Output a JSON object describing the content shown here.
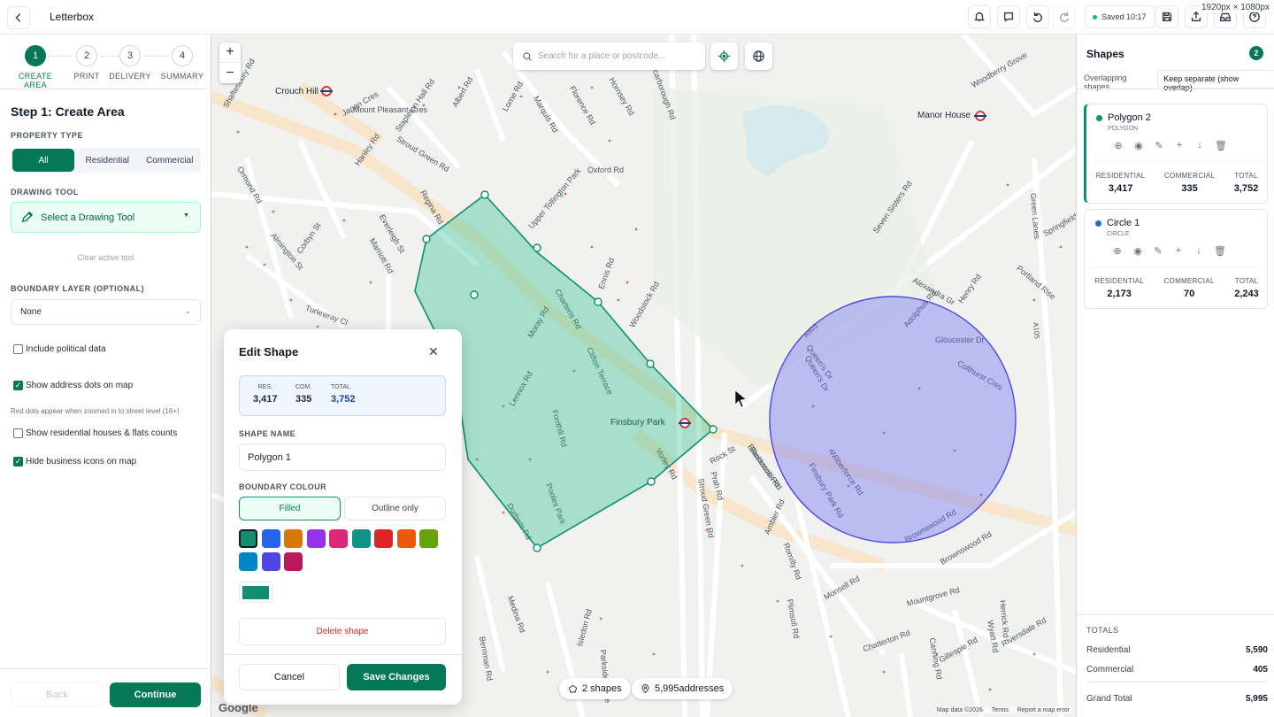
{
  "header": {
    "app_title": "Letterbox",
    "saved_status": "Saved 10:17",
    "resolution": "1920px × 1080px"
  },
  "steps": [
    {
      "num": "1",
      "label": "CREATE AREA"
    },
    {
      "num": "2",
      "label": "PRINT"
    },
    {
      "num": "3",
      "label": "DELIVERY"
    },
    {
      "num": "4",
      "label": "SUMMARY"
    }
  ],
  "left": {
    "heading": "Step 1: Create Area",
    "property_type_label": "PROPERTY TYPE",
    "property_types": [
      "All",
      "Residential",
      "Commercial"
    ],
    "drawing_tool_label": "DRAWING TOOL",
    "drawing_tool_value": "Select a Drawing Tool",
    "clear_tool": "Clear active tool",
    "boundary_label": "BOUNDARY LAYER (OPTIONAL)",
    "boundary_value": "None",
    "include_political": "Include political data",
    "show_dots": "Show address dots on map",
    "dots_hint": "Red dots appear when zoomed in to street level (16+)",
    "show_counts": "Show residential houses & flats counts",
    "hide_business": "Hide business icons on map",
    "back": "Back",
    "continue": "Continue"
  },
  "map": {
    "search_placeholder": "Search for a place or postcode...",
    "zoom_in": "+",
    "zoom_out": "−",
    "shapes_pill": "2 shapes",
    "addresses_pill": "5,995addresses",
    "attribution": [
      "Map data ©2026",
      "Terms",
      "Report a map error"
    ],
    "google": "Google",
    "labels": [
      "Crouch Hill",
      "Manor House",
      "Finsbury Park",
      "Stroud Green Rd",
      "Seven Sisters Rd",
      "Blackstock Rd",
      "Brownswood Rd",
      "Green Lanes",
      "Queen's Dr",
      "Wilberforce Rd",
      "Gloucester Dr",
      "Oxford Rd",
      "Clifton Terrace",
      "Fonthill Rd",
      "Lennox Rd",
      "Upper Tollington Park",
      "Woodstock Rd",
      "Stapleton Hall Rd",
      "Albert Rd",
      "Marquis Rd",
      "Florence Rd",
      "Hornsey Rd",
      "Mount Pleasant Cres",
      "Hanley Rd",
      "Everleigh St",
      "Marriott Rd",
      "Corbyn St",
      "Almington St",
      "Ormond Rd",
      "Turlewray Cl",
      "Durham Rd",
      "Pooles Park",
      "Medina Rd",
      "Isledon Rd",
      "Romilly Rd",
      "Plimsoll Rd",
      "Mountgrove Rd",
      "Chatterton Rd",
      "Monsell Rd",
      "Gillespie Rd",
      "Riversdale Rd",
      "Canning Rd",
      "Wyatt Rd",
      "Herrick Rd",
      "Rock St",
      "Prah Rd",
      "Ambler Rd",
      "Stroud Green Rd",
      "Alexandra Gr",
      "Henry Rd",
      "Portland Rise",
      "Colthurst Cres",
      "Adolphus Rd",
      "A503",
      "A105",
      "Springfield",
      "Woodberry Grove",
      "Shaftesbury Rd",
      "Japan Cres",
      "Lorne Rd",
      "Regina Rd",
      "Charteris Rd",
      "Moray Rd",
      "Ennis Rd",
      "Scarborough Rd",
      "Parkside Close",
      "Berriman Rd",
      "Vorley Rd",
      "Queen's Dr",
      "Finsbury Park Rd",
      "Blackstock Rd",
      "Brownswood Rd"
    ]
  },
  "dialog": {
    "title": "Edit Shape",
    "stats": [
      {
        "k": "RES.",
        "v": "3,417"
      },
      {
        "k": "COM.",
        "v": "335"
      },
      {
        "k": "TOTAL",
        "v": "3,752"
      }
    ],
    "name_label": "SHAPE NAME",
    "name_value": "Polygon 1",
    "colour_label": "BOUNDARY COLOUR",
    "fill_options": [
      "Filled",
      "Outline only"
    ],
    "swatches": [
      "#0f8f6e",
      "#2563eb",
      "#d97706",
      "#9333ea",
      "#db2777",
      "#0d9488",
      "#dc2626",
      "#ea580c",
      "#65a30d",
      "#0284c7",
      "#4f46e5",
      "#be185d"
    ],
    "selected_colour": "#0f8f6e",
    "delete": "Delete shape",
    "cancel": "Cancel",
    "save": "Save Changes"
  },
  "right": {
    "title": "Shapes",
    "count": "2",
    "tabs": [
      "Overlapping shapes",
      "Keep separate (show overlap)"
    ],
    "shapes": [
      {
        "name": "Polygon 2",
        "type": "POLYGON",
        "color": "#059669",
        "stats": [
          {
            "k": "RESIDENTIAL",
            "v": "3,417"
          },
          {
            "k": "COMMERCIAL",
            "v": "335"
          },
          {
            "k": "TOTAL",
            "v": "3,752"
          }
        ]
      },
      {
        "name": "Circle 1",
        "type": "CIRCLE",
        "color": "#2563eb",
        "stats": [
          {
            "k": "RESIDENTIAL",
            "v": "2,173"
          },
          {
            "k": "COMMERCIAL",
            "v": "70"
          },
          {
            "k": "TOTAL",
            "v": "2,243"
          }
        ]
      }
    ],
    "totals_label": "TOTALS",
    "totals": [
      {
        "k": "Residential",
        "v": "5,590"
      },
      {
        "k": "Commercial",
        "v": "405"
      },
      {
        "k": "Grand Total",
        "v": "5,995"
      }
    ]
  }
}
